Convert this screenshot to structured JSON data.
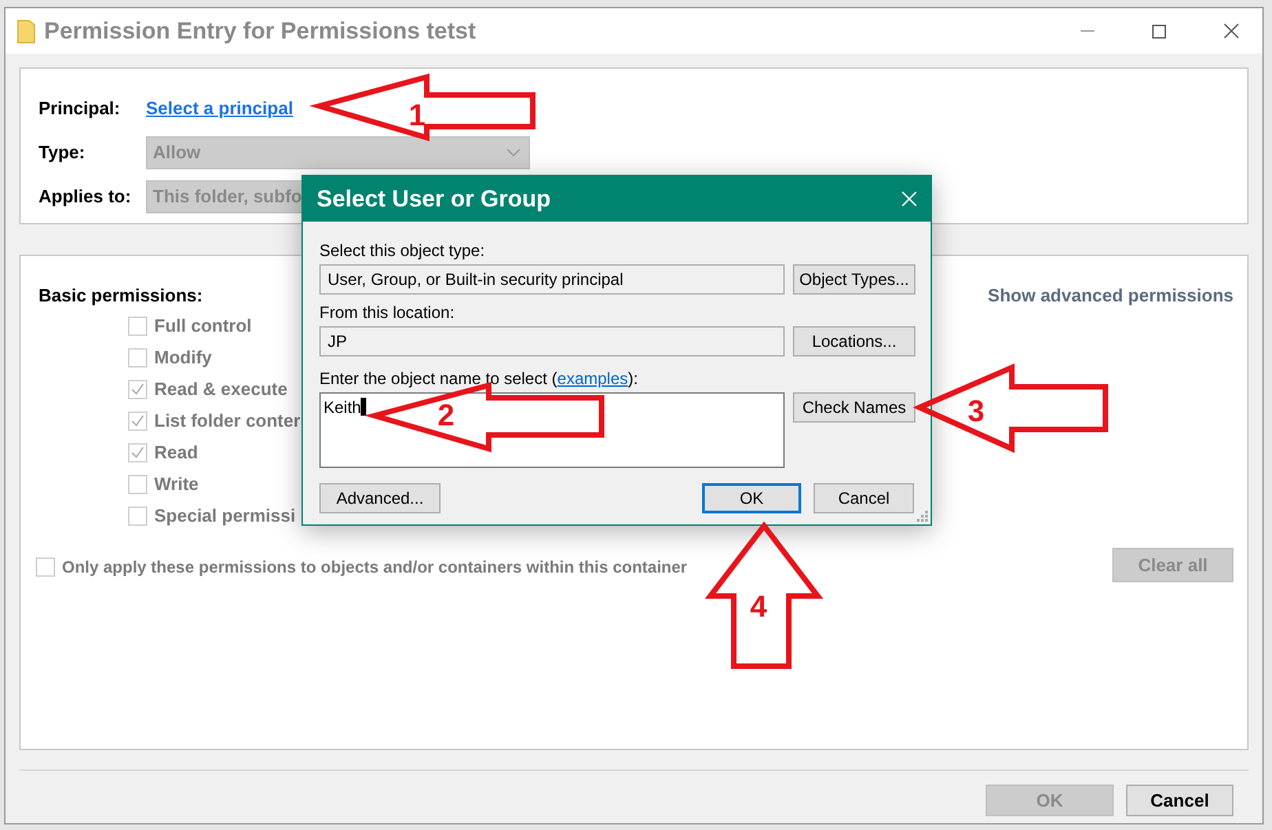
{
  "window": {
    "title": "Permission Entry for Permissions tetst"
  },
  "principal": {
    "label": "Principal:",
    "link": "Select a principal"
  },
  "type": {
    "label": "Type:",
    "value": "Allow",
    "disabled": true
  },
  "applies_to": {
    "label": "Applies to:",
    "value": "This folder, subfo",
    "disabled": true
  },
  "permissions": {
    "heading": "Basic permissions:",
    "advanced_link": "Show advanced permissions",
    "items": [
      {
        "label": "Full control",
        "checked": false
      },
      {
        "label": "Modify",
        "checked": false
      },
      {
        "label": "Read & execute",
        "checked": true
      },
      {
        "label": "List folder conter",
        "checked": true
      },
      {
        "label": "Read",
        "checked": true
      },
      {
        "label": "Write",
        "checked": false
      },
      {
        "label": "Special permissi",
        "checked": false
      }
    ],
    "only_apply": {
      "label": "Only apply these permissions to objects and/or containers within this container",
      "checked": false
    },
    "clear_button": {
      "label": "Clear all",
      "disabled": true
    }
  },
  "buttons": [
    {
      "label": "OK",
      "disabled": true
    },
    {
      "label": "Cancel",
      "disabled": false
    }
  ],
  "dialog": {
    "title": "Select User or Group",
    "object_type": {
      "label": "Select this object type:",
      "value": "User, Group, or Built-in security principal",
      "button": "Object Types..."
    },
    "location": {
      "label": "From this location:",
      "value": "JP",
      "button": "Locations..."
    },
    "object_name": {
      "label_before": "Enter the object name to select (",
      "link": "examples",
      "label_after": "):",
      "value": "Keith",
      "button": "Check Names"
    },
    "buttons": [
      {
        "label": "Advanced...",
        "default": false
      },
      {
        "label": "OK",
        "default": true
      },
      {
        "label": "Cancel",
        "default": false
      }
    ]
  },
  "annotations": [
    {
      "number": "1"
    },
    {
      "number": "2"
    },
    {
      "number": "3"
    },
    {
      "number": "4"
    }
  ]
}
